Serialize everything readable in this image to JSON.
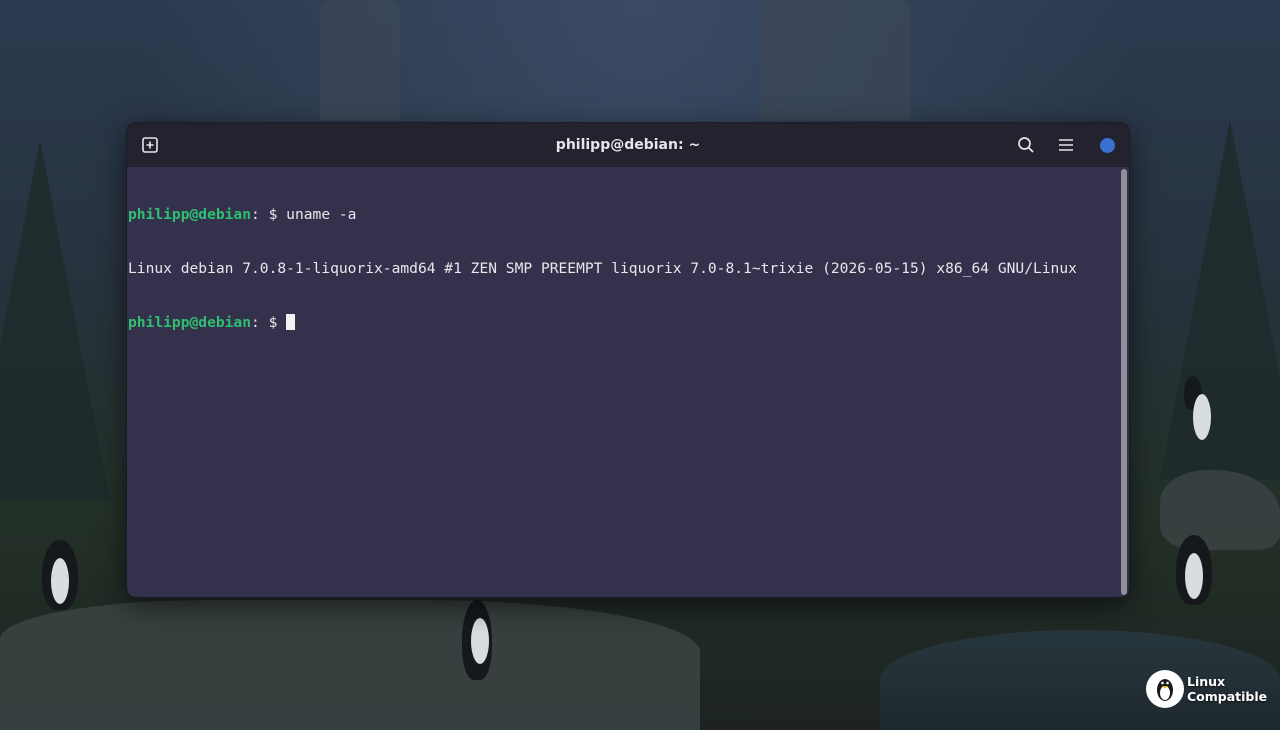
{
  "window": {
    "title": "philipp@debian: ~"
  },
  "colors": {
    "terminal_bg": "#33314b",
    "titlebar_bg": "#232330",
    "prompt_user": "#2fbf71",
    "status_dot": "#3b6fd0"
  },
  "toolbar": {
    "new_tab_icon": "new-tab-icon",
    "search_icon": "search-icon",
    "menu_icon": "hamburger-menu-icon"
  },
  "terminal": {
    "lines": [
      {
        "user": "philipp@debian",
        "suffix": ": $ ",
        "command": "uname -a"
      },
      {
        "output": "Linux debian 7.0.8-1-liquorix-amd64 #1 ZEN SMP PREEMPT liquorix 7.0-8.1~trixie (2026-05-15) x86_64 GNU/Linux"
      },
      {
        "user": "philipp@debian",
        "suffix": ": $ ",
        "command": ""
      }
    ]
  },
  "watermark": {
    "line1": "Linux",
    "line2": "Compatible"
  }
}
